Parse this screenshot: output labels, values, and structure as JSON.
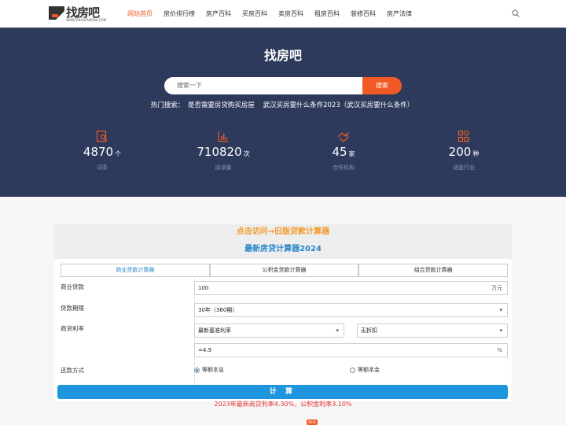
{
  "brand": {
    "name": "找房吧",
    "domain": "WWW.ZHAOFANGBA.COM"
  },
  "nav": [
    {
      "label": "网站首页",
      "active": true
    },
    {
      "label": "房价排行榜"
    },
    {
      "label": "房产百科"
    },
    {
      "label": "买房百科"
    },
    {
      "label": "卖房百科"
    },
    {
      "label": "租房百科"
    },
    {
      "label": "装修百科"
    },
    {
      "label": "房产法律"
    }
  ],
  "hero": {
    "title": "找房吧",
    "search_placeholder": "搜索一下",
    "search_button": "搜索",
    "hot_label": "热门搜索：",
    "hot_items": [
      "是否需要房贷购买房屋",
      "武汉买房要什么条件2023（武汉买房要什么条件）"
    ]
  },
  "stats": [
    {
      "icon": "search-doc-icon",
      "value": "4870",
      "unit": "个",
      "label": "词条"
    },
    {
      "icon": "bar-chart-icon",
      "value": "710820",
      "unit": "次",
      "label": "阅读量"
    },
    {
      "icon": "handshake-icon",
      "value": "45",
      "unit": "家",
      "label": "合作机构"
    },
    {
      "icon": "grid-icon",
      "value": "200",
      "unit": "种",
      "label": "涵盖行业"
    }
  ],
  "calculator": {
    "old_link": "点击访问→旧版贷款计算器",
    "title": "最新房贷计算器2024",
    "tabs": [
      {
        "label": "商业贷款计算器",
        "active": true
      },
      {
        "label": "公积金贷款计算器"
      },
      {
        "label": "组合贷款计算器"
      }
    ],
    "rows": {
      "loan_label": "商业贷款",
      "loan_value": "100",
      "loan_unit": "万元",
      "term_label": "贷款期限",
      "term_value": "30年（360期）",
      "rate_label": "商贷利率",
      "rate_type": "最新基准利率",
      "rate_discount": "无折扣",
      "rate_value": "=4.9",
      "rate_unit": "%",
      "repay_label": "还款方式",
      "repay_option_1": "等额本息",
      "repay_option_2": "等额本金"
    },
    "button": "计 算",
    "note": "2023年最新商贷利率4.30%，公积金利率3.10%"
  },
  "badge": "NEW",
  "colors": {
    "accent": "#f15a24",
    "hero_bg": "#2d3a5b",
    "blue": "#1f95de"
  }
}
